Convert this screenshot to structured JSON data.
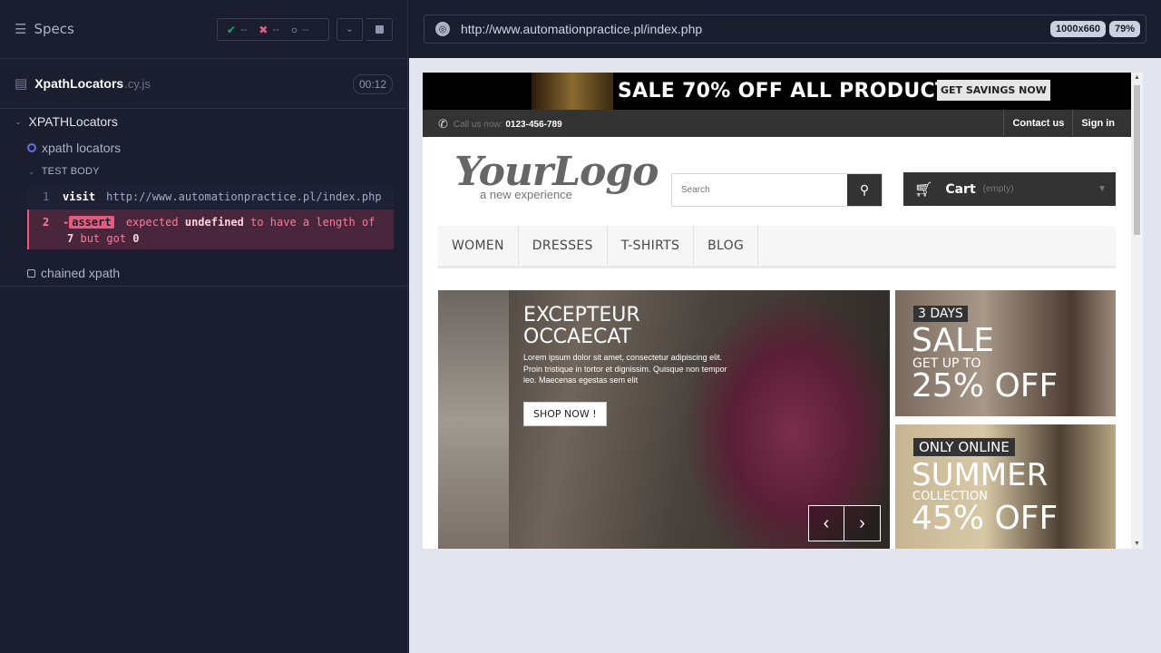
{
  "reporter": {
    "specs_label": "Specs",
    "stats": {
      "passed": "--",
      "failed": "--",
      "pending": "--"
    },
    "file": {
      "name": "XpathLocators",
      "ext": ".cy.js",
      "duration": "00:12"
    },
    "suite": "XPATHLocators",
    "tests": [
      {
        "title": "xpath locators",
        "state": "running"
      },
      {
        "title": "chained xpath",
        "state": "pending"
      }
    ],
    "test_body_label": "TEST BODY",
    "commands": [
      {
        "num": "1",
        "name": "visit",
        "message": "http://www.automationpractice.pl/index.php"
      },
      {
        "num": "2",
        "name": "assert",
        "prefix": "-",
        "message_parts": [
          "expected",
          "undefined",
          "to have a length of",
          "7",
          "but got",
          "0"
        ]
      }
    ]
  },
  "aut": {
    "url": "http://www.automationpractice.pl/index.php",
    "viewport": "1000x660",
    "zoom": "79%"
  },
  "site": {
    "promo_text": "SALE 70% OFF ALL PRODUCTS",
    "promo_button": "GET SAVINGS NOW",
    "call_label": "Call us now:",
    "phone": "0123-456-789",
    "nav_links": [
      "Contact us",
      "Sign in"
    ],
    "logo_main": "YourLogo",
    "logo_sub": "a new experience",
    "search_placeholder": "Search",
    "cart_label": "Cart",
    "cart_state": "(empty)",
    "menu": [
      "WOMEN",
      "DRESSES",
      "T-SHIRTS",
      "BLOG"
    ],
    "slide": {
      "title_line1": "EXCEPTEUR",
      "title_line2": "OCCAECAT",
      "text": "Lorem ipsum dolor sit amet, consectetur adipiscing elit. Proin tristique in tortor et dignissim. Quisque non tempor leo. Maecenas egestas sem elit",
      "button": "SHOP NOW !"
    },
    "banner1": {
      "tag": "3 DAYS",
      "big": "SALE",
      "mid": "GET UP TO",
      "pct": "25% OFF"
    },
    "banner2": {
      "tag": "ONLY ONLINE",
      "big": "SUMMER",
      "mid": "COLLECTION",
      "pct": "45% OFF"
    }
  },
  "colors": {
    "accent_fail": "#e65c7e",
    "reporter_bg": "#1b1e2e",
    "pass": "#1fa971"
  }
}
